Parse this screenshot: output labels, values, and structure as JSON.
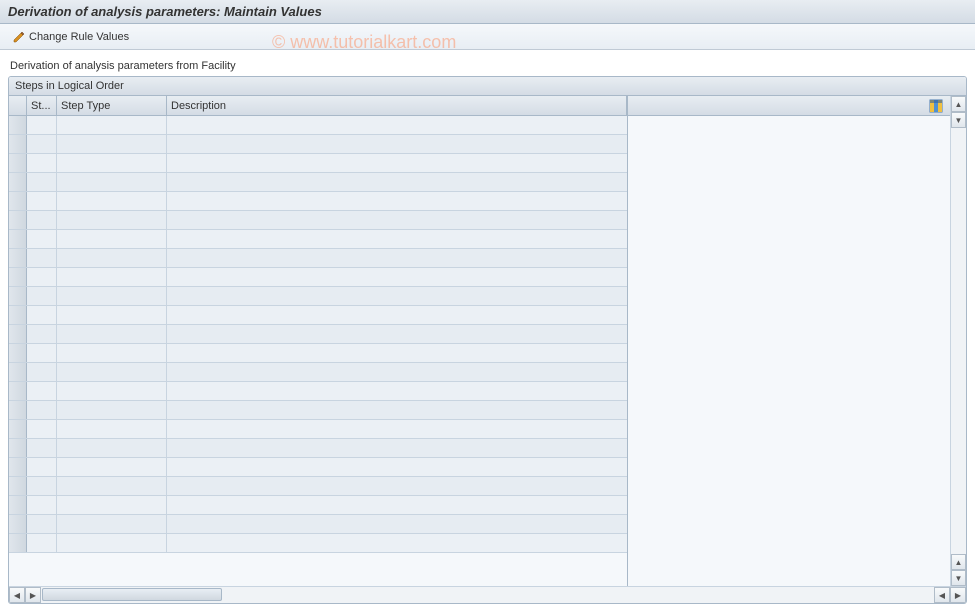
{
  "title": "Derivation of analysis parameters: Maintain Values",
  "toolbar": {
    "change_rule_values_label": "Change Rule Values"
  },
  "subtitle": "Derivation of analysis parameters from Facility",
  "panel": {
    "header": "Steps in Logical Order"
  },
  "columns": {
    "selector": "",
    "st": "St...",
    "steptype": "Step Type",
    "description": "Description"
  },
  "rows": [
    {
      "st": "",
      "steptype": "",
      "description": ""
    },
    {
      "st": "",
      "steptype": "",
      "description": ""
    },
    {
      "st": "",
      "steptype": "",
      "description": ""
    },
    {
      "st": "",
      "steptype": "",
      "description": ""
    },
    {
      "st": "",
      "steptype": "",
      "description": ""
    },
    {
      "st": "",
      "steptype": "",
      "description": ""
    },
    {
      "st": "",
      "steptype": "",
      "description": ""
    },
    {
      "st": "",
      "steptype": "",
      "description": ""
    },
    {
      "st": "",
      "steptype": "",
      "description": ""
    },
    {
      "st": "",
      "steptype": "",
      "description": ""
    },
    {
      "st": "",
      "steptype": "",
      "description": ""
    },
    {
      "st": "",
      "steptype": "",
      "description": ""
    },
    {
      "st": "",
      "steptype": "",
      "description": ""
    },
    {
      "st": "",
      "steptype": "",
      "description": ""
    },
    {
      "st": "",
      "steptype": "",
      "description": ""
    },
    {
      "st": "",
      "steptype": "",
      "description": ""
    },
    {
      "st": "",
      "steptype": "",
      "description": ""
    },
    {
      "st": "",
      "steptype": "",
      "description": ""
    },
    {
      "st": "",
      "steptype": "",
      "description": ""
    },
    {
      "st": "",
      "steptype": "",
      "description": ""
    },
    {
      "st": "",
      "steptype": "",
      "description": ""
    },
    {
      "st": "",
      "steptype": "",
      "description": ""
    },
    {
      "st": "",
      "steptype": "",
      "description": ""
    }
  ],
  "watermark": "© www.tutorialkart.com"
}
